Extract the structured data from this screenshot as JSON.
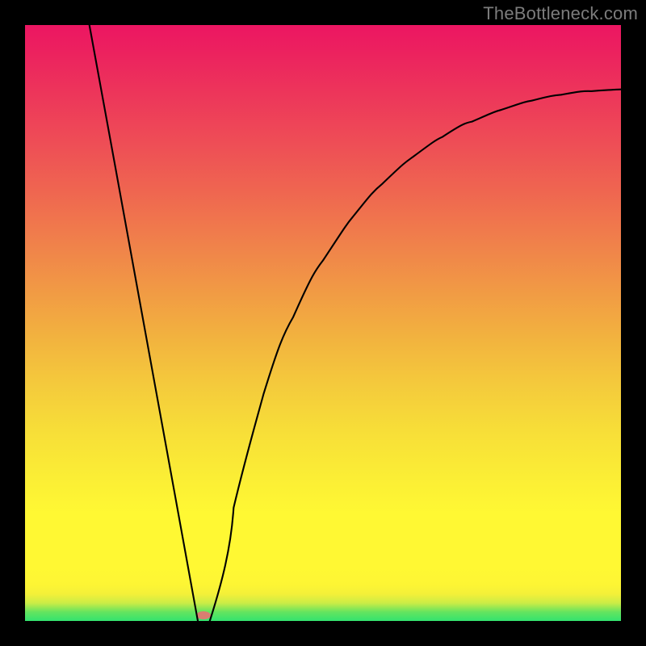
{
  "watermark": "TheBottleneck.com",
  "colors": {
    "frame": "#000000",
    "gradient_top": "#ec1662",
    "gradient_bottom": "#33e36f",
    "curve_stroke": "#000000",
    "marker_fill": "#d97e71",
    "watermark_text": "#7c7c7c"
  },
  "chart_data": {
    "type": "line",
    "title": "",
    "xlabel": "",
    "ylabel": "",
    "xlim": [
      0,
      1
    ],
    "ylim": [
      0,
      1
    ],
    "series": [
      {
        "name": "left-branch",
        "x": [
          0.108,
          0.15,
          0.2,
          0.25,
          0.29
        ],
        "y": [
          1.0,
          0.77,
          0.495,
          0.22,
          0.0
        ]
      },
      {
        "name": "right-branch",
        "x": [
          0.31,
          0.35,
          0.4,
          0.45,
          0.5,
          0.55,
          0.6,
          0.65,
          0.7,
          0.75,
          0.8,
          0.85,
          0.9,
          0.95,
          1.0
        ],
        "y": [
          0.0,
          0.19,
          0.38,
          0.51,
          0.605,
          0.678,
          0.734,
          0.778,
          0.812,
          0.838,
          0.858,
          0.873,
          0.883,
          0.889,
          0.892
        ]
      }
    ],
    "marker": {
      "x": 0.3,
      "y": 0.01
    },
    "background_gradient": {
      "orientation": "vertical",
      "stops": [
        {
          "pos": 0.0,
          "color": "#33e36f"
        },
        {
          "pos": 0.05,
          "color": "#fdf534"
        },
        {
          "pos": 0.18,
          "color": "#fff833"
        },
        {
          "pos": 0.5,
          "color": "#f2a840"
        },
        {
          "pos": 1.0,
          "color": "#ec1662"
        }
      ]
    }
  }
}
